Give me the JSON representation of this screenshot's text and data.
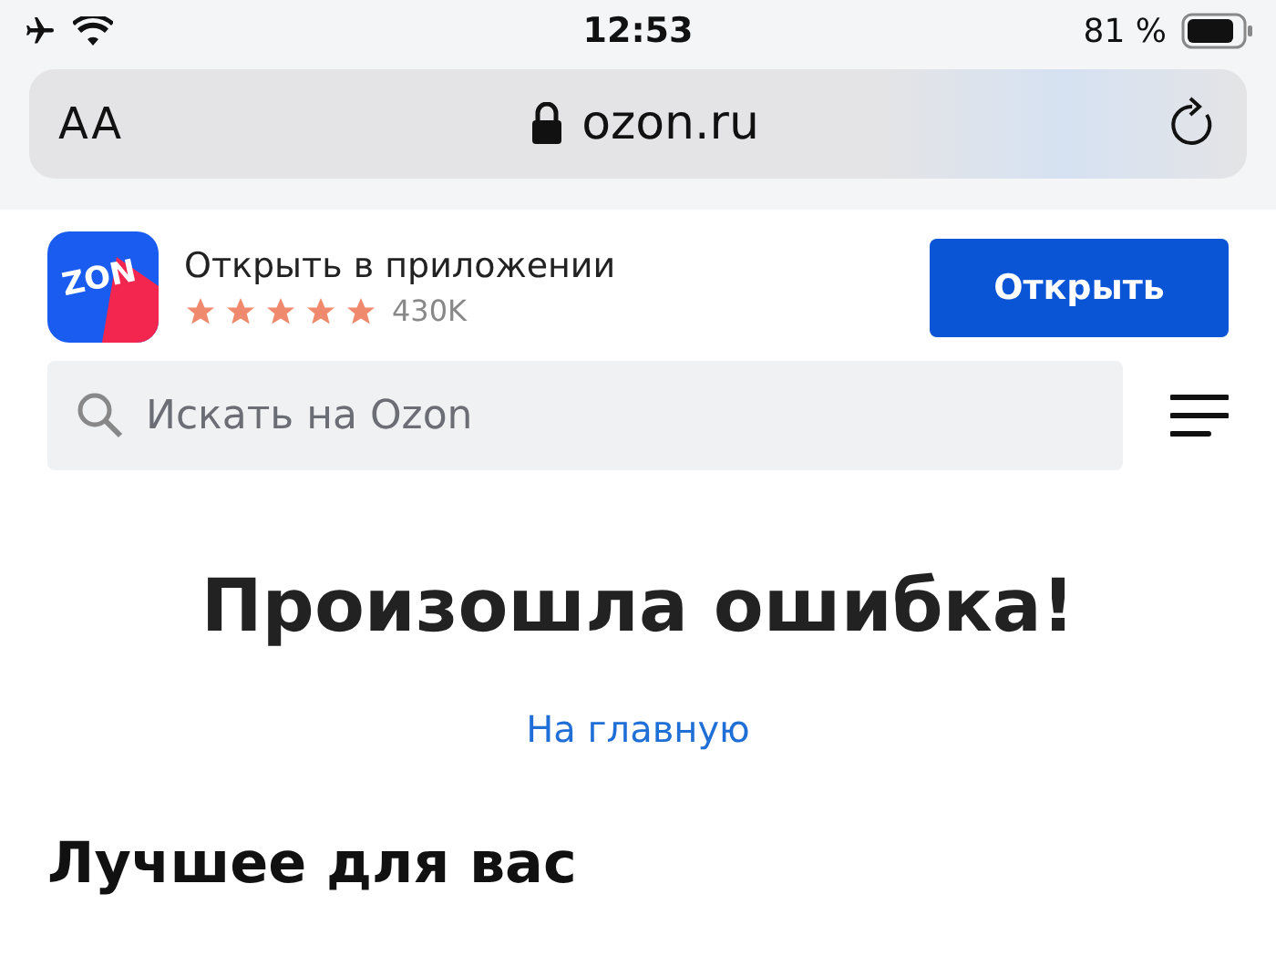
{
  "status_bar": {
    "time": "12:53",
    "battery": "81 %"
  },
  "address_bar": {
    "text_size": "AA",
    "url": "ozon.ru"
  },
  "app_banner": {
    "logo_text": "ZON",
    "title": "Открыть в приложении",
    "stars": 5,
    "reviews": "430K",
    "button": "Открыть"
  },
  "search": {
    "placeholder": "Искать на Ozon"
  },
  "error": {
    "title": "Произошла ошибка!",
    "link": "На главную"
  },
  "section": {
    "title": "Лучшее для вас"
  }
}
